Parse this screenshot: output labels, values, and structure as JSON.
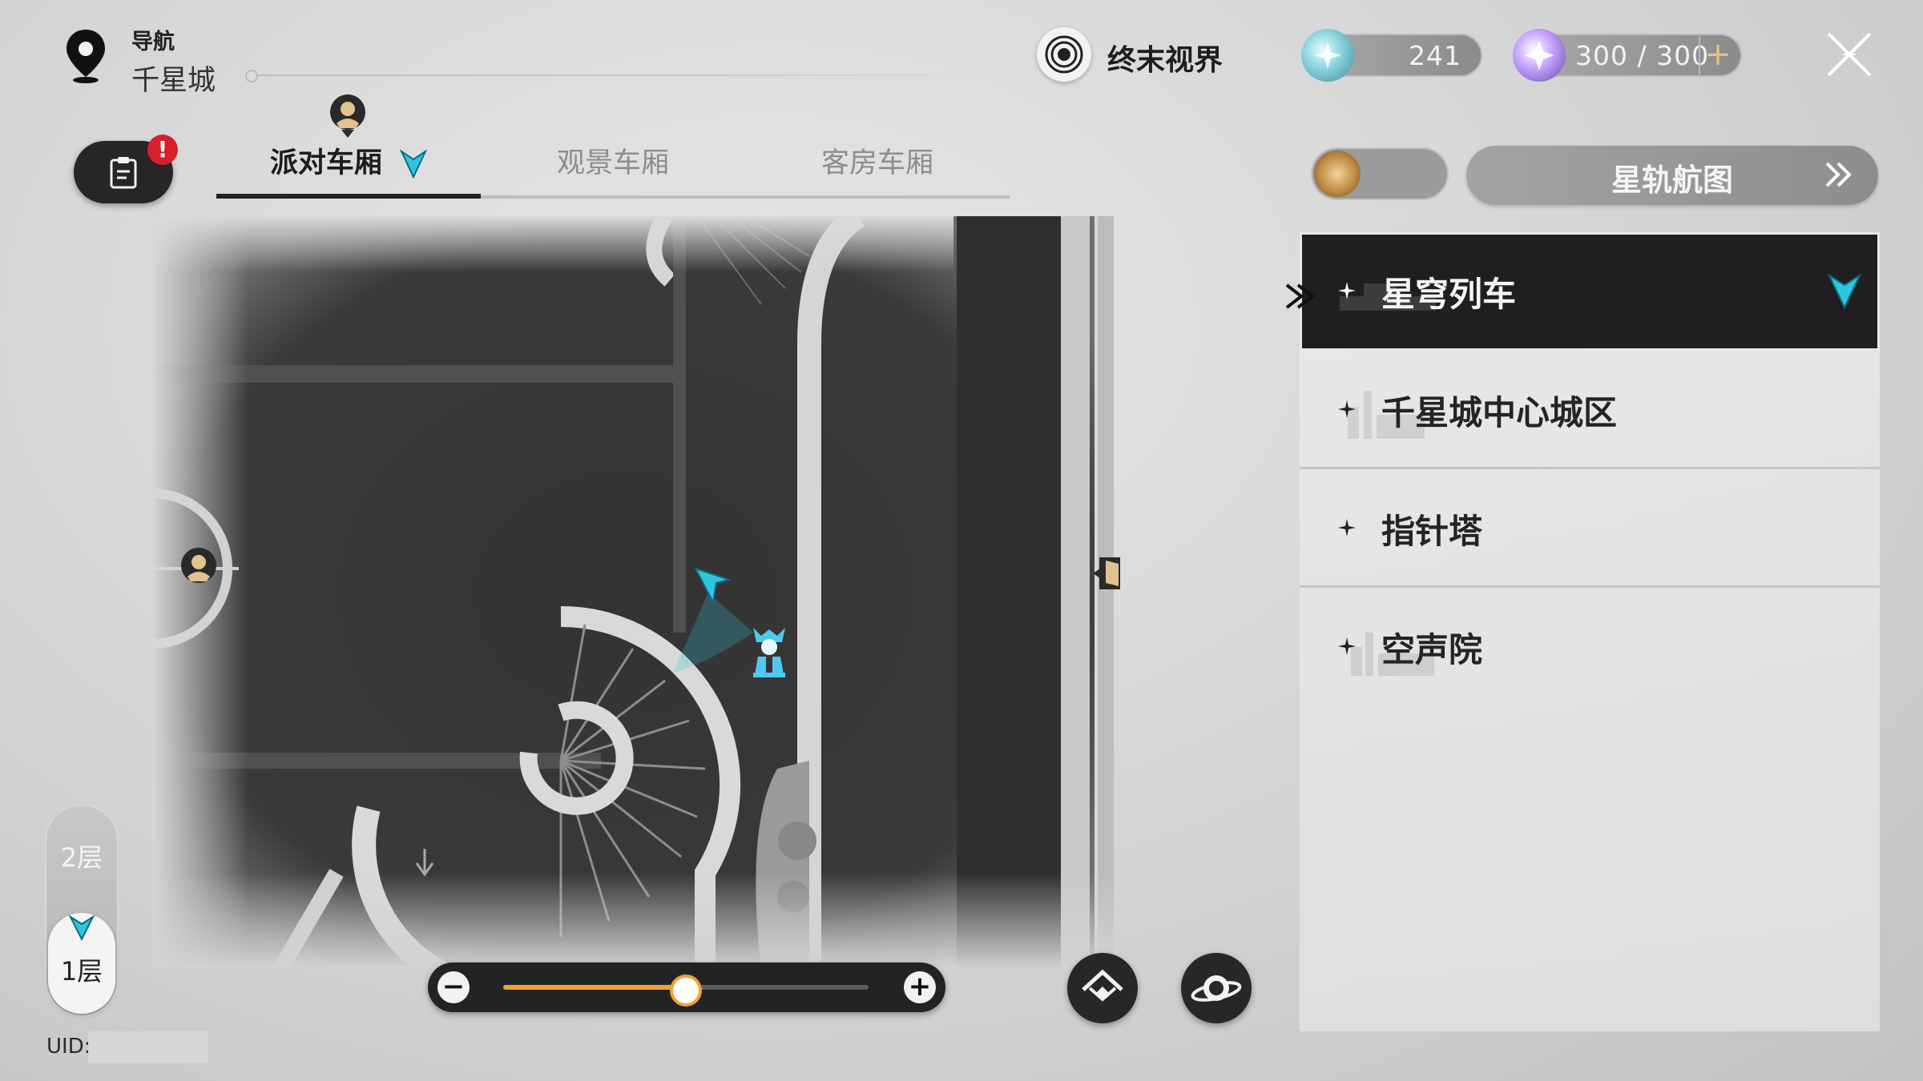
{
  "navigation": {
    "label": "导航",
    "location": "千星城"
  },
  "realm": {
    "label": "终末视界"
  },
  "currencies": [
    {
      "icon": "stellar-jade-icon",
      "value": "241"
    },
    {
      "icon": "trailblaze-power-icon",
      "value": "300 / 300",
      "plus": "+"
    }
  ],
  "quest": {
    "badge": "!"
  },
  "tabs": [
    {
      "label": "派对车厢",
      "active": true
    },
    {
      "label": "观景车厢",
      "active": false
    },
    {
      "label": "客房车厢",
      "active": false
    }
  ],
  "floors": {
    "upper": "2层",
    "current": "1层"
  },
  "uid": {
    "label": "UID:"
  },
  "zoom": {
    "minus": "−",
    "plus": "+",
    "level": 0.5
  },
  "star_rail_map": {
    "label": "星轨航图"
  },
  "locations": [
    {
      "label": "星穹列车",
      "active": true
    },
    {
      "label": "千星城中心城区",
      "active": false
    },
    {
      "label": "指针塔",
      "active": false
    },
    {
      "label": "空声院",
      "active": false
    }
  ],
  "colors": {
    "accent_cyan": "#2fc4e0",
    "accent_orange": "#f0a13a",
    "badge_red": "#d8202a"
  }
}
